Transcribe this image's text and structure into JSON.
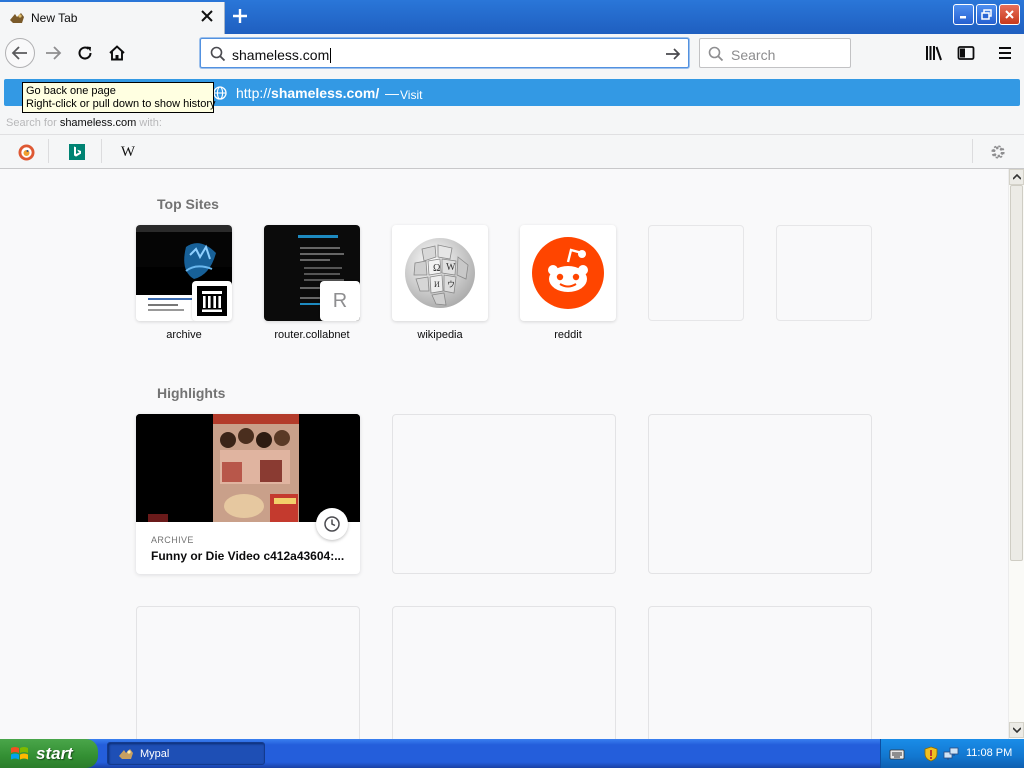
{
  "tab": {
    "title": "New Tab"
  },
  "navbar": {
    "url_value": "shameless.com",
    "search_placeholder": "Search"
  },
  "tooltip": {
    "line1": "Go back one page",
    "line2": "Right-click or pull down to show history"
  },
  "popup": {
    "url_prefix": "http://",
    "url_bold": "shameless.com/",
    "dash": "—",
    "visit_label": "Visit",
    "search_for_label": "Search for",
    "search_for_term": "shameless.com",
    "search_for_suffix": "with:",
    "engines": [
      "duckduckgo-icon",
      "bing-icon",
      "wikipedia-icon"
    ],
    "wikipedia_glyph": "W"
  },
  "top_sites": {
    "title": "Top Sites",
    "items": [
      {
        "label": "archive",
        "icon": "archive-icon"
      },
      {
        "label": "router.collabnet",
        "badge_letter": "R"
      },
      {
        "label": "wikipedia",
        "icon": "wikipedia-globe-icon"
      },
      {
        "label": "reddit",
        "icon": "reddit-icon"
      },
      {
        "label": ""
      },
      {
        "label": ""
      }
    ]
  },
  "highlights": {
    "title": "Highlights",
    "cards": [
      {
        "context": "ARCHIVE",
        "title": "Funny or Die Video c412a43604:..."
      }
    ]
  },
  "taskbar": {
    "start_label": "start",
    "task_label": "Mypal",
    "clock": "11:08 PM"
  },
  "colors": {
    "accent": "#3399e4",
    "reddit": "#ff4500",
    "taskbar": "#245edb",
    "start": "#338f33"
  }
}
